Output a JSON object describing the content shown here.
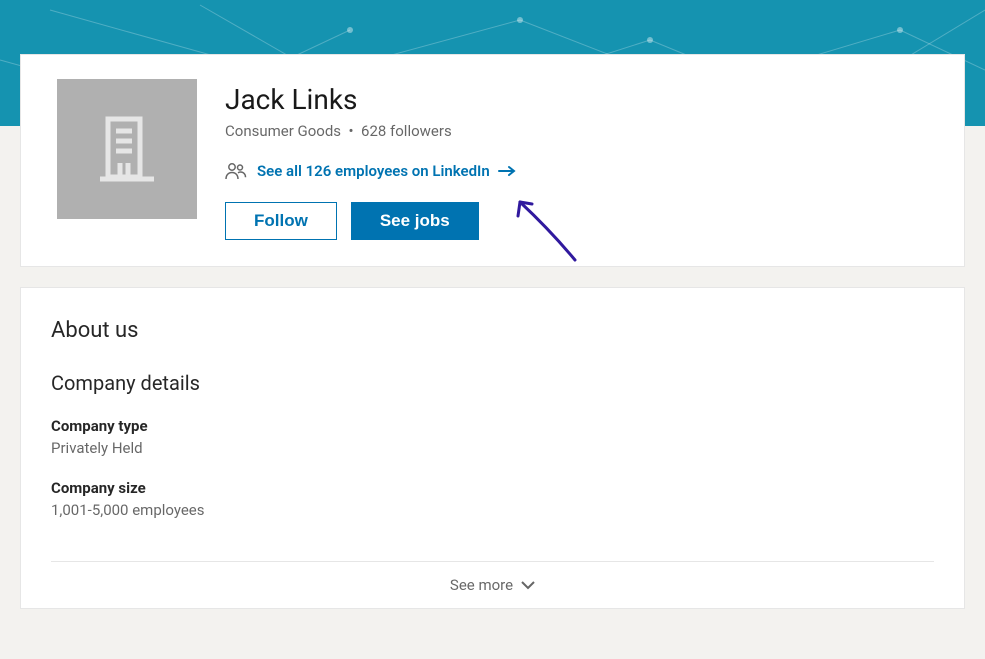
{
  "profile": {
    "name": "Jack Links",
    "industry": "Consumer Goods",
    "followers_text": "628 followers",
    "employees_link": "See all 126 employees on LinkedIn",
    "follow_label": "Follow",
    "see_jobs_label": "See jobs"
  },
  "about": {
    "heading": "About us",
    "details_heading": "Company details",
    "fields": {
      "type_label": "Company type",
      "type_value": "Privately Held",
      "size_label": "Company size",
      "size_value": "1,001-5,000 employees"
    },
    "see_more": "See more"
  }
}
